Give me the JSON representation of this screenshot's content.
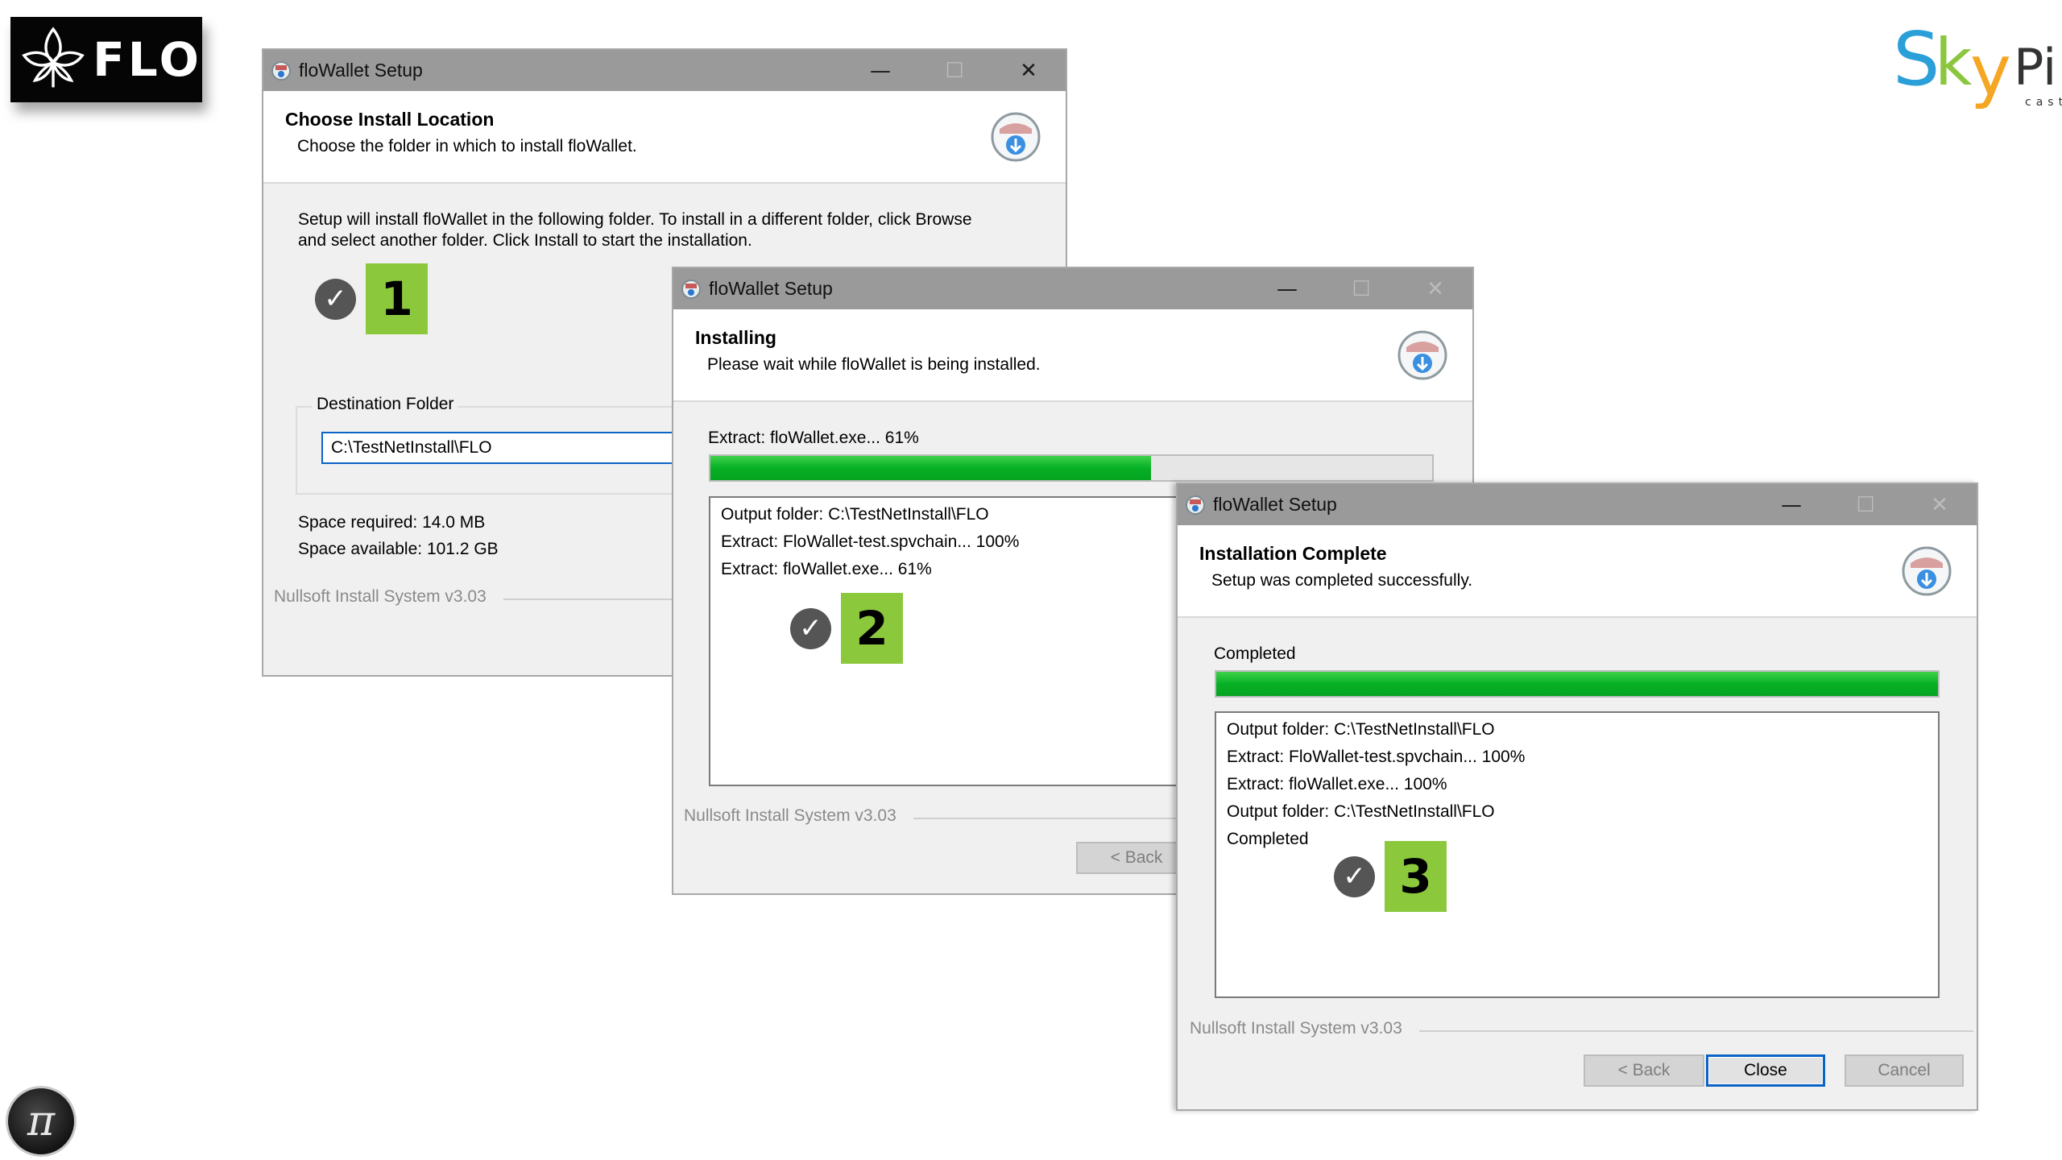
{
  "brand": {
    "left_logo_text": "FLO",
    "right_logo_text": "SkyPi",
    "right_logo_subtext": "cast",
    "avatar_glyph": "π"
  },
  "dialog1": {
    "title": "floWallet Setup",
    "header_title": "Choose Install Location",
    "header_subtitle": "Choose the folder in which to install floWallet.",
    "body_line1": "Setup will install floWallet in the following folder. To install in a different folder, click Browse",
    "body_line2": "and select another folder. Click Install to start the installation.",
    "step_number": "1",
    "destination_label": "Destination Folder",
    "destination_value": "C:\\TestNetInstall\\FLO",
    "space_required": "Space required: 14.0 MB",
    "space_available": "Space available: 101.2 GB",
    "footer": "Nullsoft Install System v3.03"
  },
  "dialog2": {
    "title": "floWallet Setup",
    "header_title": "Installing",
    "header_subtitle": "Please wait while floWallet is being installed.",
    "status": "Extract: floWallet.exe... 61%",
    "progress_percent": 61,
    "log": [
      "Output folder: C:\\TestNetInstall\\FLO",
      "Extract: FloWallet-test.spvchain... 100%",
      "Extract: floWallet.exe... 61%"
    ],
    "step_number": "2",
    "footer": "Nullsoft Install System v3.03",
    "back_label": "< Back"
  },
  "dialog3": {
    "title": "floWallet Setup",
    "header_title": "Installation Complete",
    "header_subtitle": "Setup was completed successfully.",
    "status": "Completed",
    "progress_percent": 100,
    "log": [
      "Output folder: C:\\TestNetInstall\\FLO",
      "Extract: FloWallet-test.spvchain... 100%",
      "Extract: floWallet.exe... 100%",
      "Output folder: C:\\TestNetInstall\\FLO",
      "Completed"
    ],
    "step_number": "3",
    "footer": "Nullsoft Install System v3.03",
    "back_label": "< Back",
    "close_label": "Close",
    "cancel_label": "Cancel"
  },
  "icons": [
    "flo-leaf-icon",
    "installer-icon",
    "minimize-icon",
    "maximize-icon",
    "close-icon",
    "check-circle-icon"
  ],
  "colors": {
    "titlebar": "#9a9a9a",
    "progress_green": "#06b025",
    "step_badge": "#8cc83c",
    "focus_blue": "#0b63c5"
  }
}
